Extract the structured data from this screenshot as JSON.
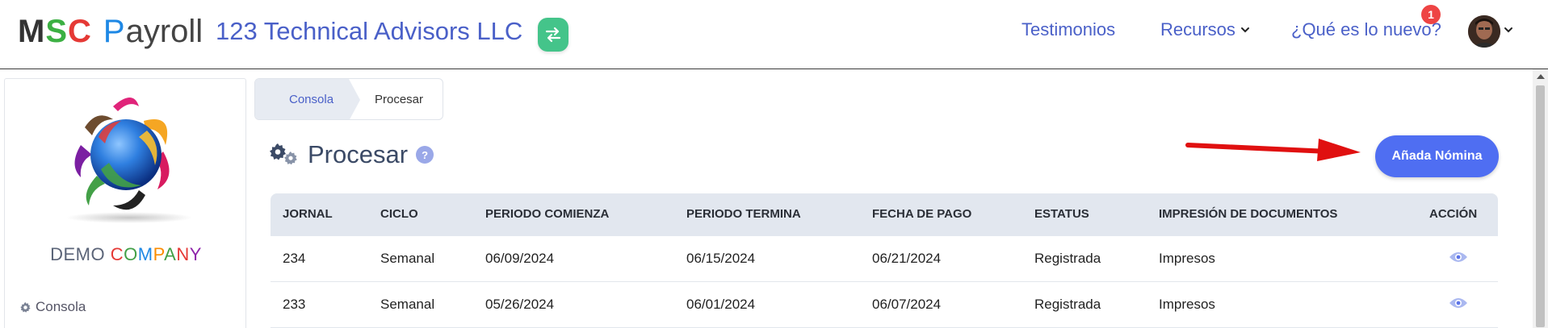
{
  "brand": {
    "logo_letters": [
      "M",
      "S",
      "C",
      "P"
    ],
    "logo_suffix": "ayroll",
    "company": "123 Technical Advisors LLC"
  },
  "nav": {
    "testimonios": "Testimonios",
    "recursos": "Recursos",
    "nuevo": "¿Qué es lo nuevo?",
    "notification_count": "1"
  },
  "sidebar": {
    "company_letters": [
      "DEMO ",
      "C",
      "O",
      "M",
      "P",
      "A",
      "N",
      "Y"
    ],
    "company_letter_colors": [
      "#5b6478",
      "#e53935",
      "#43a047",
      "#1e88e5",
      "#fb8c00",
      "#43a047",
      "#e53935",
      "#8e24aa"
    ],
    "items": [
      {
        "label": "Consola",
        "icon": "gear-icon"
      }
    ]
  },
  "breadcrumb": {
    "items": [
      "Consola",
      "Procesar"
    ]
  },
  "page": {
    "title": "Procesar",
    "help": "?",
    "add_button": "Añada Nómina"
  },
  "table": {
    "columns": [
      "JORNAL",
      "CICLO",
      "PERIODO COMIENZA",
      "PERIODO TERMINA",
      "FECHA DE PAGO",
      "ESTATUS",
      "IMPRESIÓN DE DOCUMENTOS",
      "ACCIÓN"
    ],
    "rows": [
      [
        "234",
        "Semanal",
        "06/09/2024",
        "06/15/2024",
        "06/21/2024",
        "Registrada",
        "Impresos"
      ],
      [
        "233",
        "Semanal",
        "05/26/2024",
        "06/01/2024",
        "06/07/2024",
        "Registrada",
        "Impresos"
      ]
    ]
  },
  "colors": {
    "accent": "#4f6ef2",
    "link": "#4a60c8",
    "switch": "#44c48a",
    "logo_m": "#333333",
    "logo_s": "#3cb043",
    "logo_c": "#e53935",
    "logo_p": "#1e88e5",
    "annotation_arrow": "#e01010"
  }
}
